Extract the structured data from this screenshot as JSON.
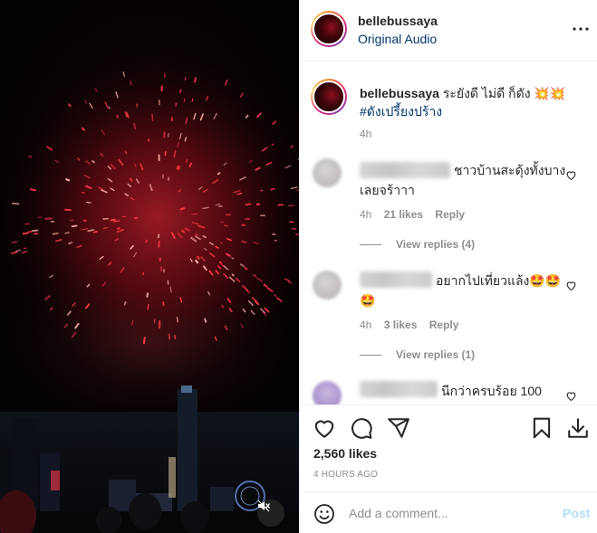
{
  "header": {
    "username": "bellebussaya",
    "audio": "Original Audio"
  },
  "caption": {
    "username": "bellebussaya",
    "text": " ระยังดี ไม่ดี ก็ดัง 💥💥",
    "hashtag": "#ดังเปรี้ยงปร้าง",
    "time": "4h"
  },
  "comments": [
    {
      "text": "ชาวบ้านสะดุ้งทั้งบางเลยจร้าาา",
      "time": "4h",
      "likes": "21 likes",
      "reply": "Reply",
      "view_replies": "View replies (4)"
    },
    {
      "text": "อยากไปเที่ยวแล้ง🤩🤩🤩",
      "time": "4h",
      "likes": "3 likes",
      "reply": "Reply",
      "view_replies": "View replies (1)"
    },
    {
      "text": "นีกว่าครบร้อย 100"
    }
  ],
  "actions": {
    "likes": "2,560 likes",
    "posted": "4 HOURS AGO"
  },
  "add_comment": {
    "placeholder": "Add a comment...",
    "post_label": "Post"
  },
  "colors": {
    "link": "#00376b",
    "muted": "#8e8e8e",
    "post_disabled": "#b2dffc",
    "firework": "#ff2a3a"
  }
}
